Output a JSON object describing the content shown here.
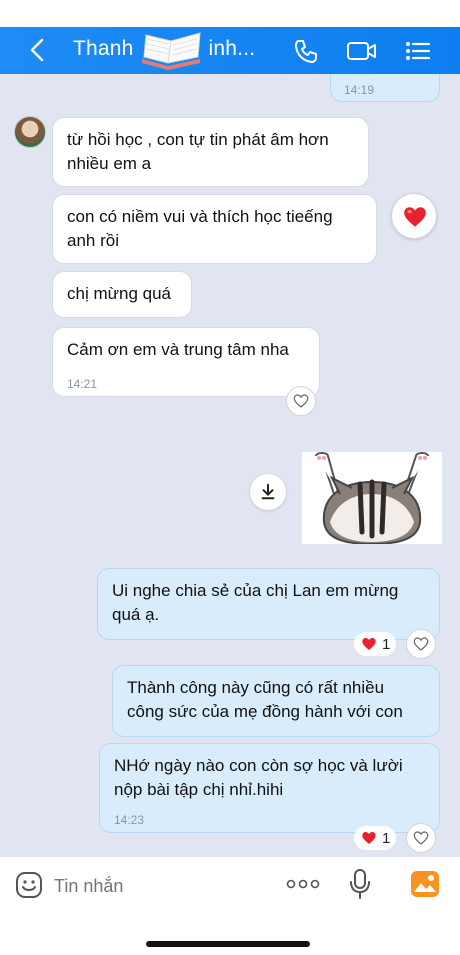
{
  "header": {
    "title_left": "Thanh",
    "title_right": "inh...",
    "back_icon": "chevron-left-icon",
    "call_icon": "phone-icon",
    "video_icon": "video-camera-icon",
    "menu_icon": "list-menu-icon"
  },
  "messages": [
    {
      "id": "m0",
      "direction": "out",
      "text": "",
      "time": "14:19"
    },
    {
      "id": "m1",
      "direction": "in",
      "text": "từ hồi học , con tự tin phát âm hơn nhiều em a"
    },
    {
      "id": "m2",
      "direction": "in",
      "text": "con có niềm vui và thích học tieếng anh rồi",
      "reaction": "heart"
    },
    {
      "id": "m3",
      "direction": "in",
      "text": "chị mừng quá"
    },
    {
      "id": "m4",
      "direction": "in",
      "text": "Cảm ơn em và trung tâm nha",
      "time": "14:21"
    },
    {
      "id": "m5",
      "direction": "out",
      "type": "sticker",
      "sticker": "cat-arms-up-sticker"
    },
    {
      "id": "m6",
      "direction": "out",
      "text": "Ui nghe chia sẻ của chị Lan em mừng quá ạ.",
      "reaction_count": "1"
    },
    {
      "id": "m7",
      "direction": "out",
      "text": "Thành công này cũng có rất nhiều công sức của mẹ đồng hành với con"
    },
    {
      "id": "m8",
      "direction": "out",
      "text": "NHớ ngày nào con còn sợ học và lười nộp bài tập chị nhỉ.hihi",
      "time": "14:23",
      "reaction_count": "1"
    }
  ],
  "composer": {
    "placeholder": "Tin nhắn",
    "emoji_icon": "emoji-face-icon",
    "more_icon": "more-dots-icon",
    "mic_icon": "microphone-icon",
    "image_icon": "image-gallery-icon"
  },
  "colors": {
    "header": "#1f8cf5",
    "chat_bg": "#e1e5f1",
    "incoming": "#ffffff",
    "outgoing": "#d8ecfc",
    "heart": "#e8212e"
  }
}
